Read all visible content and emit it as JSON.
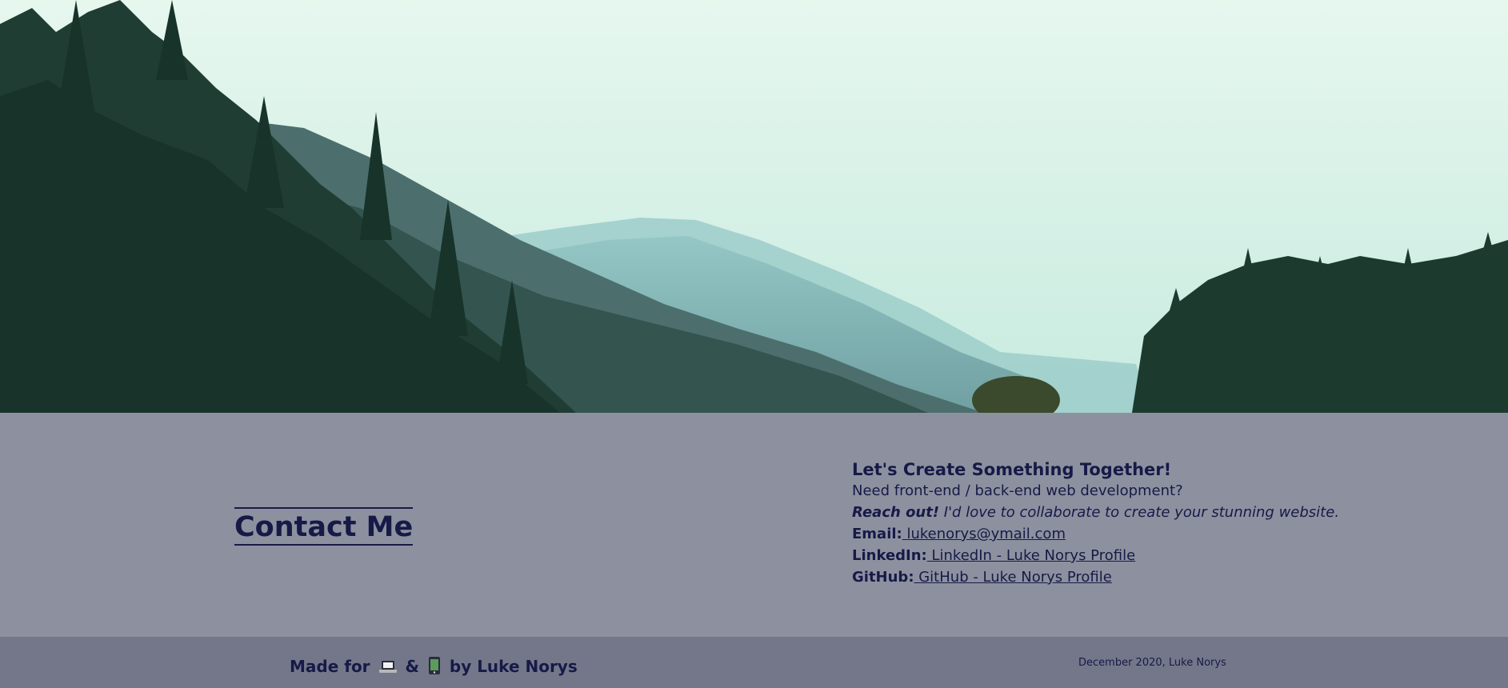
{
  "hero": {
    "icon": "forest-landscape-image"
  },
  "contact": {
    "title": "Contact Me",
    "heading": "Let's Create Something Together!",
    "subtitle": "Need front-end / back-end web development?",
    "reach_bold": "Reach out!",
    "reach_text": " I'd love to collaborate to create your stunning website.",
    "email_label": "Email:",
    "email_value": " lukenorys@ymail.com",
    "linkedin_label": "LinkedIn:",
    "linkedin_value": " LinkedIn - Luke Norys Profile",
    "github_label": "GitHub:",
    "github_value": " GitHub - Luke Norys Profile"
  },
  "footer": {
    "made_for": "Made for",
    "ampersand": "&",
    "by": "by Luke Norys",
    "laptop_icon": "laptop-icon",
    "phone_icon": "mobile-phone-icon",
    "date": "December 2020, Luke Norys"
  },
  "colors": {
    "text": "#171a47",
    "contact_bg": "#8d919f",
    "footer_bg": "#737789"
  }
}
